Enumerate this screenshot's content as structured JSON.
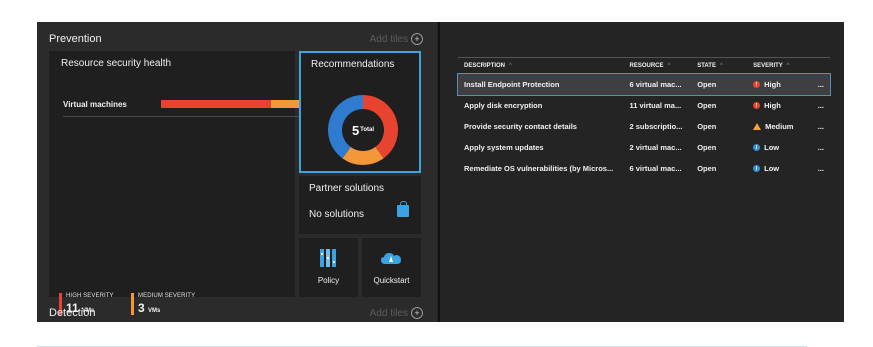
{
  "prevention": {
    "title": "Prevention",
    "add_tiles": "Add tiles"
  },
  "detection": {
    "title": "Detection",
    "add_tiles": "Add tiles"
  },
  "resource_health": {
    "title": "Resource security health",
    "row_label": "Virtual machines",
    "high": {
      "label": "HIGH SEVERITY",
      "count": "11",
      "unit": "VMs",
      "color": "#e8432f"
    },
    "medium": {
      "label": "MEDIUM SEVERITY",
      "count": "3",
      "unit": "VMs",
      "color": "#f29839"
    }
  },
  "recommendations": {
    "title": "Recommendations",
    "total_value": "5",
    "total_label": "Total",
    "chart_data": {
      "type": "pie",
      "values": [
        2,
        1,
        2
      ],
      "colors": [
        "#e8432f",
        "#f29839",
        "#2f7bd0"
      ]
    }
  },
  "partner": {
    "title": "Partner solutions",
    "status": "No solutions"
  },
  "policy": {
    "label": "Policy"
  },
  "quickstart": {
    "label": "Quickstart"
  },
  "table": {
    "headers": [
      "DESCRIPTION",
      "RESOURCE",
      "STATE",
      "SEVERITY"
    ],
    "rows": [
      {
        "description": "Install Endpoint Protection",
        "resource": "6 virtual mac...",
        "state": "Open",
        "severity": "High",
        "level": "high"
      },
      {
        "description": "Apply disk encryption",
        "resource": "11 virtual ma...",
        "state": "Open",
        "severity": "High",
        "level": "high"
      },
      {
        "description": "Provide security contact details",
        "resource": "2 subscriptio...",
        "state": "Open",
        "severity": "Medium",
        "level": "medium"
      },
      {
        "description": "Apply system updates",
        "resource": "2 virtual mac...",
        "state": "Open",
        "severity": "Low",
        "level": "low"
      },
      {
        "description": "Remediate OS vulnerabilities (by Micros...",
        "resource": "6 virtual mac...",
        "state": "Open",
        "severity": "Low",
        "level": "low"
      }
    ],
    "more": "..."
  },
  "colors": {
    "accent": "#3ba3e2",
    "high": "#e8432f",
    "medium": "#f29839",
    "low": "#3b8fdc"
  }
}
